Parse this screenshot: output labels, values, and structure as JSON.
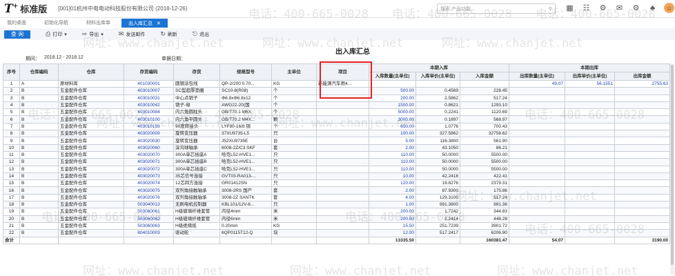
{
  "app": {
    "logo": "T",
    "logo_sup": "+",
    "edition": "标准版",
    "company": "[001]01杭州中电电动科技股份有限公司  (2018-12-26)",
    "search_placeholder": "搜索:产品功能"
  },
  "tabs": [
    {
      "label": "我的桌面",
      "active": false
    },
    {
      "label": "初始化导航",
      "active": false
    },
    {
      "label": "材料出库单",
      "active": false
    },
    {
      "label": "出入库汇总",
      "active": true
    }
  ],
  "toolbar": {
    "query": "查 询",
    "print": "打印",
    "export": "导出",
    "email": "发送邮件",
    "refresh": "刷新",
    "exit": "退出"
  },
  "watermark": {
    "phone": "电话：400-665-0028",
    "site": "网址：www.chanjet.net"
  },
  "report": {
    "title": "出入库汇总",
    "period_label": "期间：",
    "period_value": "2018.12 - 2018.12",
    "date_label": "单据日期："
  },
  "columns": {
    "seq": "序号",
    "wh_code": "仓库编码",
    "warehouse": "仓库",
    "inv_code": "存货编码",
    "inventory": "存货",
    "spec": "规格型号",
    "unit": "主单位",
    "project": "项目",
    "in_group": "本期入库",
    "out_group": "本期出库",
    "in_qty": "入库数量(主单位)",
    "in_price": "入库单价(主单位)",
    "in_amount": "入库金额",
    "out_qty": "出库数量(主单位)",
    "out_price": "出库单价(主单位)",
    "out_amount": "出库金额"
  },
  "rows": [
    {
      "seq": "1",
      "wh": "A",
      "whn": "原材料库",
      "code": "401030001",
      "name": "圆钢涂包线",
      "spec": "QP-2/200 0.70...",
      "unit": "KG",
      "proj": "新能源汽车用4...",
      "iq": "",
      "ip": "",
      "ia": "",
      "oq": "49.07",
      "op": "56.1551",
      "oa": "2755.63"
    },
    {
      "seq": "2",
      "wh": "B",
      "whn": "五金配件仓库",
      "code": "403010007",
      "name": "SC型超厚垫圈",
      "spec": "SC10-8(R08)",
      "unit": "个",
      "proj": "",
      "iq": "500.00",
      "ip": "0.4569",
      "ia": "228.45",
      "oq": "",
      "op": "",
      "oa": ""
    },
    {
      "seq": "3",
      "wh": "B",
      "whn": "五金配件仓库",
      "code": "403010031",
      "name": "中心点销子",
      "spec": "Φ6.8xΦ6.8x12",
      "unit": "个",
      "proj": "",
      "iq": "200.00",
      "ip": "2.5862",
      "ia": "517.24",
      "oq": "",
      "op": "",
      "oa": ""
    },
    {
      "seq": "4",
      "wh": "B",
      "whn": "五金配件仓库",
      "code": "403010042",
      "name": "销子-母",
      "spec": "AWG22-20(国",
      "unit": "个",
      "proj": "",
      "iq": "1500.00",
      "ip": "0.8621",
      "ia": "1293.10",
      "oq": "",
      "op": "",
      "oa": ""
    },
    {
      "seq": "5",
      "wh": "B",
      "whn": "五金配件仓库",
      "code": "403010084",
      "name": "内六角圆柱头",
      "spec": "GB/T70.1 M6X",
      "unit": "个",
      "proj": "",
      "iq": "5000.00",
      "ip": "0.2241",
      "ia": "1120.69",
      "oq": "",
      "op": "",
      "oa": ""
    },
    {
      "seq": "6",
      "wh": "B",
      "whn": "五金配件仓库",
      "code": "403010100",
      "name": "内六角平圆头",
      "spec": "GB/T70.2 M4X...",
      "unit": "颗",
      "proj": "",
      "iq": "3000.00",
      "ip": "0.1897",
      "ia": "568.97",
      "oq": "",
      "op": "",
      "oa": ""
    },
    {
      "seq": "7",
      "wh": "B",
      "whn": "五金配件仓库",
      "code": "403010159",
      "name": "90度转接头",
      "spec": "LYF90-16/8 铜",
      "unit": "个",
      "proj": "",
      "iq": "650.00",
      "ip": "1.0776",
      "ia": "700.43",
      "oq": "",
      "op": "",
      "oa": ""
    },
    {
      "seq": "8",
      "wh": "B",
      "whn": "五金配件仓库",
      "code": "403020009",
      "name": "旋转变压器",
      "spec": "37XU9735-L5",
      "unit": "只",
      "proj": "",
      "iq": "100.00",
      "ip": "327.5862",
      "ia": "32758.62",
      "oq": "",
      "op": "",
      "oa": ""
    },
    {
      "seq": "9",
      "wh": "B",
      "whn": "五金配件仓库",
      "code": "403020030",
      "name": "旋转变压器",
      "spec": "J52XU9735E",
      "unit": "台",
      "proj": "",
      "iq": "5.00",
      "ip": "116.3800",
      "ia": "581.90",
      "oq": "",
      "op": "",
      "oa": ""
    },
    {
      "seq": "10",
      "wh": "B",
      "whn": "五金配件仓库",
      "code": "403020060",
      "name": "深沟球轴承",
      "spec": "6008-2Z/C3 SKF",
      "unit": "套",
      "proj": "",
      "iq": "2.00",
      "ip": "43.1050",
      "ia": "86.21",
      "oq": "",
      "op": "",
      "oa": ""
    },
    {
      "seq": "11",
      "wh": "B",
      "whn": "五金配件仓库",
      "code": "403020070",
      "name": "300A单芯插座A",
      "spec": "哈克L52-HVE1...",
      "unit": "只",
      "proj": "",
      "iq": "110.00",
      "ip": "50.0000",
      "ia": "5500.00",
      "oq": "",
      "op": "",
      "oa": ""
    },
    {
      "seq": "12",
      "wh": "B",
      "whn": "五金配件仓库",
      "code": "403020071",
      "name": "300A单芯插座B",
      "spec": "哈克L52-HVE1...",
      "unit": "只",
      "proj": "",
      "iq": "110.00",
      "ip": "50.0000",
      "ia": "5500.00",
      "oq": "",
      "op": "",
      "oa": ""
    },
    {
      "seq": "13",
      "wh": "B",
      "whn": "五金配件仓库",
      "code": "403020072",
      "name": "300A单芯插座C",
      "spec": "哈克L52-HVE1...",
      "unit": "只",
      "proj": "",
      "iq": "110.00",
      "ip": "50.0000",
      "ia": "5500.00",
      "oq": "",
      "op": "",
      "oa": ""
    },
    {
      "seq": "14",
      "wh": "B",
      "whn": "五金配件仓库",
      "code": "403020073",
      "name": "35芯信号连接",
      "spec": "GVT03-RA013-...",
      "unit": "只",
      "proj": "",
      "iq": "10.00",
      "ip": "42.2418",
      "ia": "422.41",
      "oq": "",
      "op": "",
      "oa": ""
    },
    {
      "seq": "15",
      "wh": "B",
      "whn": "五金配件仓库",
      "code": "403020074",
      "name": "12芯四方连接",
      "spec": "GR01412SN",
      "unit": "只",
      "proj": "",
      "iq": "120.00",
      "ip": "19.8276",
      "ia": "2379.31",
      "oq": "",
      "op": "",
      "oa": ""
    },
    {
      "seq": "16",
      "wh": "B",
      "whn": "五金配件仓库",
      "code": "403020075",
      "name": "双列角接触轴承",
      "spec": "3008-2RS 国产",
      "unit": "套",
      "proj": "",
      "iq": "2.00",
      "ip": "87.9300",
      "ia": "175.86",
      "oq": "",
      "op": "",
      "oa": ""
    },
    {
      "seq": "17",
      "wh": "B",
      "whn": "五金配件仓库",
      "code": "403020076",
      "name": "双列角接触轴承",
      "spec": "3008-2Z SANTK",
      "unit": "套",
      "proj": "",
      "iq": "4.00",
      "ip": "129.3100",
      "ia": "517.24",
      "oq": "",
      "op": "",
      "oa": ""
    },
    {
      "seq": "18",
      "wh": "B",
      "whn": "五金配件仓库",
      "code": "503040013",
      "name": "无刷电机控制器",
      "spec": "KBL101/12V-6...",
      "unit": "只",
      "proj": "",
      "iq": "1.00",
      "ip": "991.3800",
      "ia": "991.38",
      "oq": "",
      "op": "",
      "oa": ""
    },
    {
      "seq": "19",
      "wh": "B",
      "whn": "五金配件仓库",
      "code": "503060061",
      "name": "H级玻璃纤维套管",
      "spec": "内径4mm",
      "unit": "米",
      "proj": "",
      "iq": "200.00",
      "ip": "1.7242",
      "ia": "344.83",
      "oq": "",
      "op": "",
      "oa": ""
    },
    {
      "seq": "20",
      "wh": "B",
      "whn": "五金配件仓库",
      "code": "503060062",
      "name": "H级玻璃纤维套管",
      "spec": "内径6mm",
      "unit": "米",
      "proj": "",
      "iq": "200.00",
      "ip": "2.2414",
      "ia": "448.28",
      "oq": "",
      "op": "",
      "oa": ""
    },
    {
      "seq": "21",
      "wh": "B",
      "whn": "五金配件仓库",
      "code": "503060063",
      "name": "H级绝缘纸",
      "spec": "0.20mm",
      "unit": "KG",
      "proj": "",
      "iq": "15.50",
      "ip": "251.7239",
      "ia": "3901.72",
      "oq": "",
      "op": "",
      "oa": ""
    },
    {
      "seq": "22",
      "wh": "B",
      "whn": "五金配件仓库",
      "code": "804010003",
      "name": "驱动轮",
      "spec": "6QP0115T12-Q",
      "unit": "块",
      "proj": "",
      "iq": "12.00",
      "ip": "517.2417",
      "ia": "6206.90",
      "oq": "",
      "op": "",
      "oa": ""
    }
  ],
  "totals": {
    "label": "合计",
    "in_qty": "13335.50",
    "in_amount": "160381.47",
    "out_qty": "54.07",
    "out_amount": "3190.00"
  }
}
